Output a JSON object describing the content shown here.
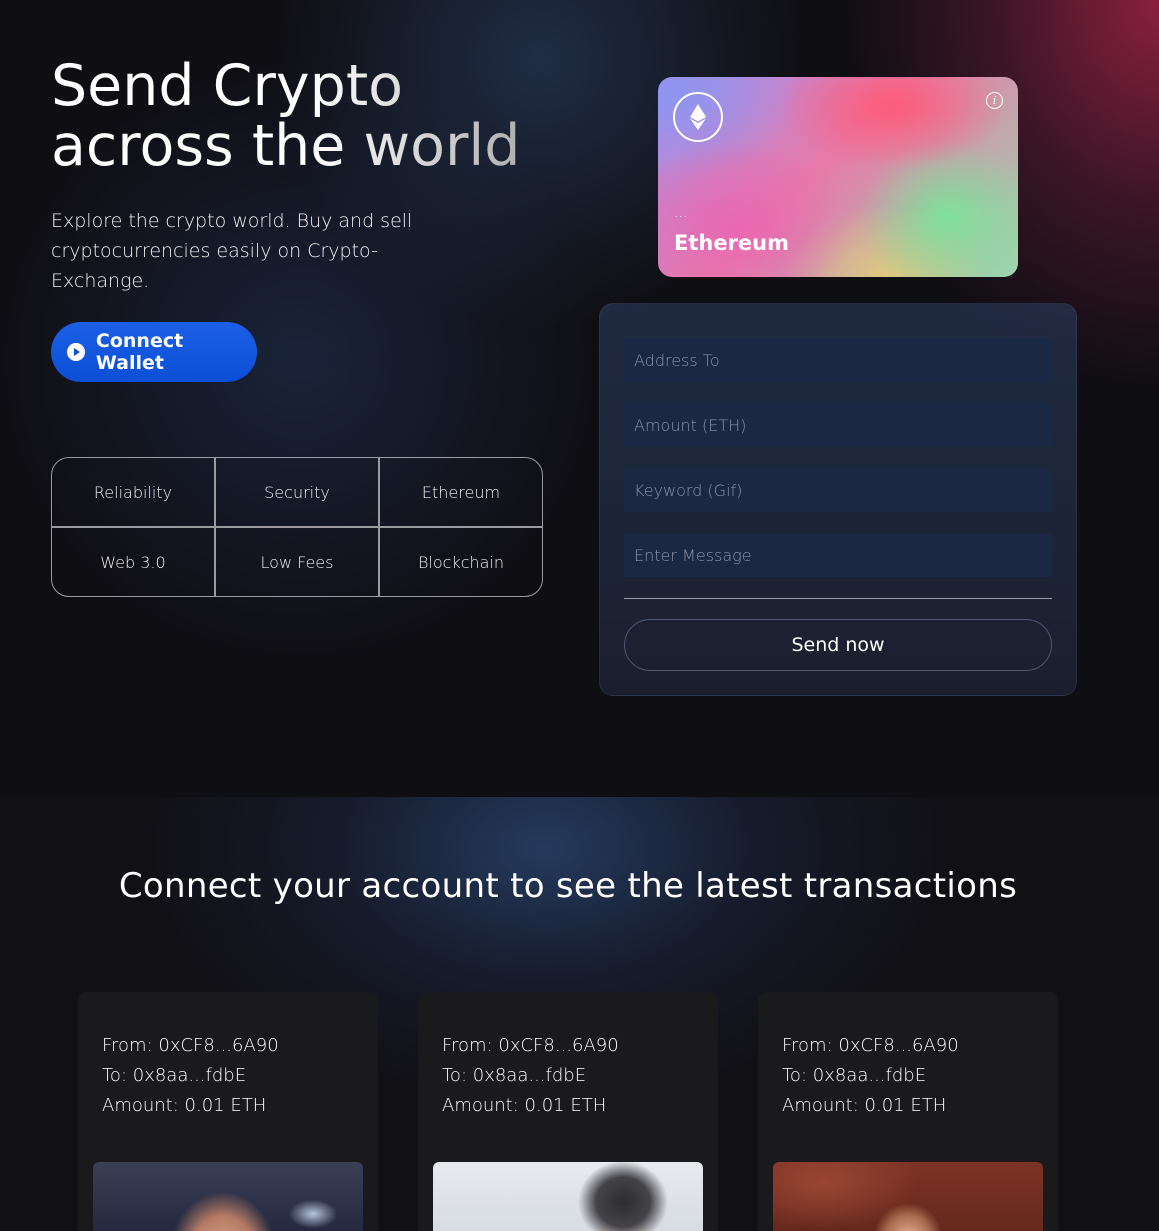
{
  "hero": {
    "title_line1": "Send Crypto",
    "title_line2": "across the world",
    "subtitle": "Explore the crypto world. Buy and sell cryptocurrencies easily on Crypto-Exchange.",
    "connect_label": "Connect Wallet",
    "connect_icon": "play-circle-icon",
    "features": [
      "Reliability",
      "Security",
      "Ethereum",
      "Web 3.0",
      "Low Fees",
      "Blockchain"
    ]
  },
  "eth_card": {
    "icon": "ethereum-icon",
    "info_icon": "info-icon",
    "info_glyph": "i",
    "address": "...",
    "name": "Ethereum"
  },
  "form": {
    "address_placeholder": "Address To",
    "amount_placeholder": "Amount (ETH)",
    "keyword_placeholder": "Keyword (Gif)",
    "message_placeholder": "Enter Message",
    "send_label": "Send now"
  },
  "transactions": {
    "heading": "Connect your account to see the latest transactions",
    "items": [
      {
        "from": "From: 0xCF8...6A90",
        "to": "To: 0x8aa...fdbE",
        "amount": "Amount: 0.01 ETH"
      },
      {
        "from": "From: 0xCF8...6A90",
        "to": "To: 0x8aa...fdbE",
        "amount": "Amount: 0.01 ETH"
      },
      {
        "from": "From: 0xCF8...6A90",
        "to": "To: 0x8aa...fdbE",
        "amount": "Amount: 0.01 ETH"
      }
    ]
  },
  "colors": {
    "primary_button": "#0b4fd6",
    "background": "#0f0e13",
    "input_bg": "#1b2843"
  }
}
